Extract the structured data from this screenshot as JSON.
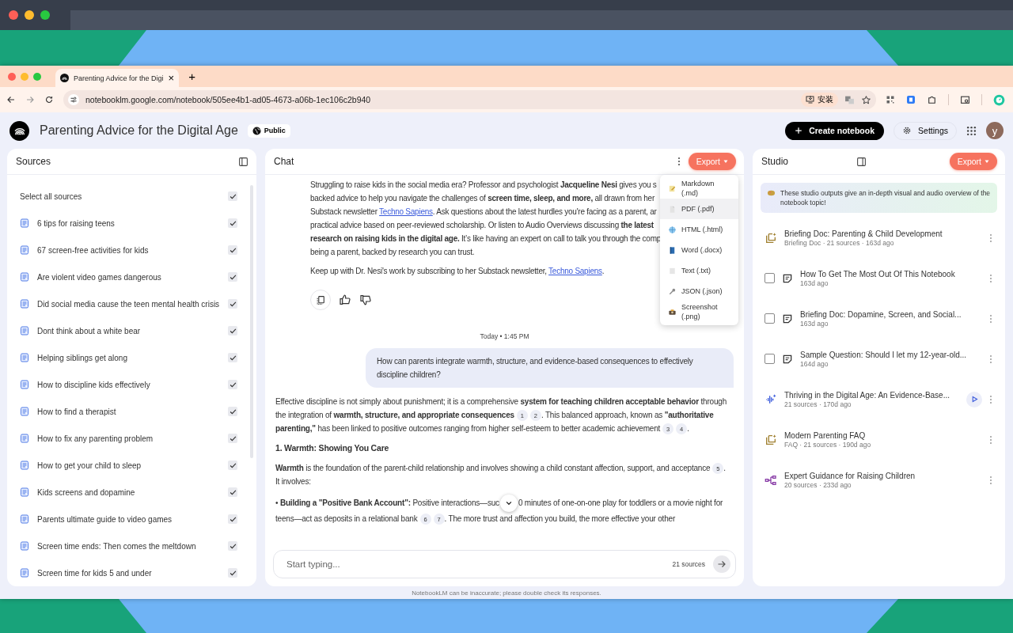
{
  "browser": {
    "tab_title": "Parenting Advice for the Digi",
    "tab_close": "×",
    "new_tab": "+",
    "url": "notebooklm.google.com/notebook/505ee4b1-ad05-4673-a06b-1ec106c2b940",
    "install_label": "安装"
  },
  "header": {
    "title": "Parenting Advice for the Digital Age",
    "visibility": "Public",
    "create_button": "Create notebook",
    "settings_button": "Settings",
    "avatar": "y"
  },
  "sources": {
    "title": "Sources",
    "select_all": {
      "label": "Select all sources",
      "checked": true
    },
    "items": [
      {
        "label": "6 tips for raising teens",
        "checked": true
      },
      {
        "label": "67 screen-free activities for kids",
        "checked": true
      },
      {
        "label": "Are violent video games dangerous",
        "checked": true
      },
      {
        "label": "Did social media cause the teen mental health crisis",
        "checked": true
      },
      {
        "label": "Dont think about a white bear",
        "checked": true
      },
      {
        "label": "Helping siblings get along",
        "checked": true
      },
      {
        "label": "How to discipline kids effectively",
        "checked": true
      },
      {
        "label": "How to find a therapist",
        "checked": true
      },
      {
        "label": "How to fix any parenting problem",
        "checked": true
      },
      {
        "label": "How to get your child to sleep",
        "checked": true
      },
      {
        "label": "Kids screens and dopamine",
        "checked": true
      },
      {
        "label": "Parents ultimate guide to video games",
        "checked": true
      },
      {
        "label": "Screen time ends: Then comes the meltdown",
        "checked": true
      },
      {
        "label": "Screen time for kids 5 and under",
        "checked": true
      }
    ]
  },
  "chat": {
    "title": "Chat",
    "export_button": "Export",
    "intro_lines": [
      [
        {
          "kind": "plain",
          "text": "Struggling to raise kids in the social media era? Professor and psychologist "
        },
        {
          "kind": "bold",
          "text": "Jacqueline Nesi"
        },
        {
          "kind": "plain",
          "text": " gives you s"
        }
      ],
      [
        {
          "kind": "plain",
          "text": "backed advice to help you navigate the challenges of "
        },
        {
          "kind": "bold",
          "text": "screen time, sleep, and more,"
        },
        {
          "kind": "plain",
          "text": " all drawn from her"
        }
      ],
      [
        {
          "kind": "plain",
          "text": "Substack newsletter "
        },
        {
          "kind": "link",
          "text": "Techno Sapiens"
        },
        {
          "kind": "plain",
          "text": ". Ask questions about the latest hurdles you're facing as a parent, ar"
        }
      ],
      [
        {
          "kind": "plain",
          "text": "practical advice based on peer-reviewed scholarship. Or listen to Audio Overviews discussing "
        },
        {
          "kind": "bold",
          "text": "the latest"
        }
      ],
      [
        {
          "kind": "bold",
          "text": "research on raising kids in the digital age."
        },
        {
          "kind": "plain",
          "text": " It’s like having an expert on call to talk you through the comp"
        }
      ],
      [
        {
          "kind": "plain",
          "text": "being a parent, backed by research you can trust."
        }
      ]
    ],
    "intro_footer": [
      {
        "kind": "plain",
        "text": "Keep up with Dr. Nesi's work by subscribing to her Substack newsletter, "
      },
      {
        "kind": "link",
        "text": "Techno Sapiens"
      },
      {
        "kind": "plain",
        "text": "."
      }
    ],
    "timestamp": "Today • 1:45 PM",
    "question": "How can parents integrate warmth, structure, and evidence-based consequences to effectively discipline children?",
    "answer": [
      {
        "kind": "paragraph",
        "segments": [
          {
            "kind": "plain",
            "text": "Effective discipline is not simply about punishment; it is a comprehensive "
          },
          {
            "kind": "bold",
            "text": "system for teaching children acceptable behavior"
          },
          {
            "kind": "plain",
            "text": " through the integration of "
          },
          {
            "kind": "bold",
            "text": "warmth, structure, and appropriate consequences"
          },
          {
            "kind": "cite",
            "text": "1"
          },
          {
            "kind": "cite",
            "text": "2"
          },
          {
            "kind": "plain",
            "text": ". This balanced approach, known as "
          },
          {
            "kind": "bold",
            "text": "\"authoritative parenting,\""
          },
          {
            "kind": "plain",
            "text": " has been linked to positive outcomes ranging from higher self-esteem to better academic achievement"
          },
          {
            "kind": "cite",
            "text": "3"
          },
          {
            "kind": "cite",
            "text": "4"
          },
          {
            "kind": "plain",
            "text": "."
          }
        ]
      },
      {
        "kind": "heading",
        "text": "1. Warmth: Showing You Care"
      },
      {
        "kind": "paragraph",
        "segments": [
          {
            "kind": "bold",
            "text": "Warmth"
          },
          {
            "kind": "plain",
            "text": " is the foundation of the parent-child relationship and involves showing a child constant affection, support, and acceptance"
          },
          {
            "kind": "cite",
            "text": "5"
          },
          {
            "kind": "plain",
            "text": ". It involves:"
          }
        ]
      },
      {
        "kind": "paragraph",
        "segments": [
          {
            "kind": "plain",
            "text": "• "
          },
          {
            "kind": "bold",
            "text": "Building a \"Positive Bank Account\":"
          },
          {
            "kind": "plain",
            "text": " Positive interactions—suc"
          },
          {
            "kind": "scroll_down"
          },
          {
            "kind": "plain",
            "text": "0 minutes of one-on-one play for toddlers or a movie night for teens—act as deposits in a relational bank"
          },
          {
            "kind": "cite",
            "text": "6"
          },
          {
            "kind": "cite",
            "text": "7"
          },
          {
            "kind": "plain",
            "text": ". The more trust and affection you build, the more effective your other"
          }
        ]
      }
    ],
    "input": {
      "placeholder": "Start typing...",
      "source_count": "21 sources"
    },
    "export_menu": [
      {
        "kind": "markdown",
        "label": "Markdown (.md)",
        "selected": false
      },
      {
        "kind": "pdf",
        "label": "PDF (.pdf)",
        "selected": true
      },
      {
        "kind": "html",
        "label": "HTML (.html)",
        "selected": false
      },
      {
        "kind": "word",
        "label": "Word (.docx)",
        "selected": false
      },
      {
        "kind": "text",
        "label": "Text (.txt)",
        "selected": false
      },
      {
        "kind": "json",
        "label": "JSON (.json)",
        "selected": false
      },
      {
        "kind": "screenshot",
        "label": "Screenshot (.png)",
        "selected": false
      }
    ]
  },
  "disclaimer": "NotebookLM can be inaccurate; please double check its responses.",
  "studio": {
    "title": "Studio",
    "export_button": "Export",
    "notice": "These studio outputs give an in-depth visual and audio overview of the notebook topic!",
    "items": [
      {
        "kind": "briefing",
        "title": "Briefing Doc: Parenting & Child Development",
        "meta": "Briefing Doc · 21 sources · 163d ago"
      },
      {
        "kind": "note",
        "title": "How To Get The Most Out Of This Notebook",
        "meta": "163d ago",
        "checked": false
      },
      {
        "kind": "note",
        "title": "Briefing Doc: Dopamine, Screen, and Social...",
        "meta": "163d ago",
        "checked": false
      },
      {
        "kind": "note",
        "title": "Sample Question: Should I let my 12-year-old...",
        "meta": "164d ago",
        "checked": false
      },
      {
        "kind": "audio",
        "title": "Thriving in the Digital Age: An Evidence-Base...",
        "meta": "21 sources · 170d ago"
      },
      {
        "kind": "briefing",
        "title": "Modern Parenting FAQ",
        "meta": "FAQ · 21 sources · 190d ago"
      },
      {
        "kind": "mindmap",
        "title": "Expert Guidance for Raising Children",
        "meta": "20 sources · 233d ago"
      }
    ]
  }
}
